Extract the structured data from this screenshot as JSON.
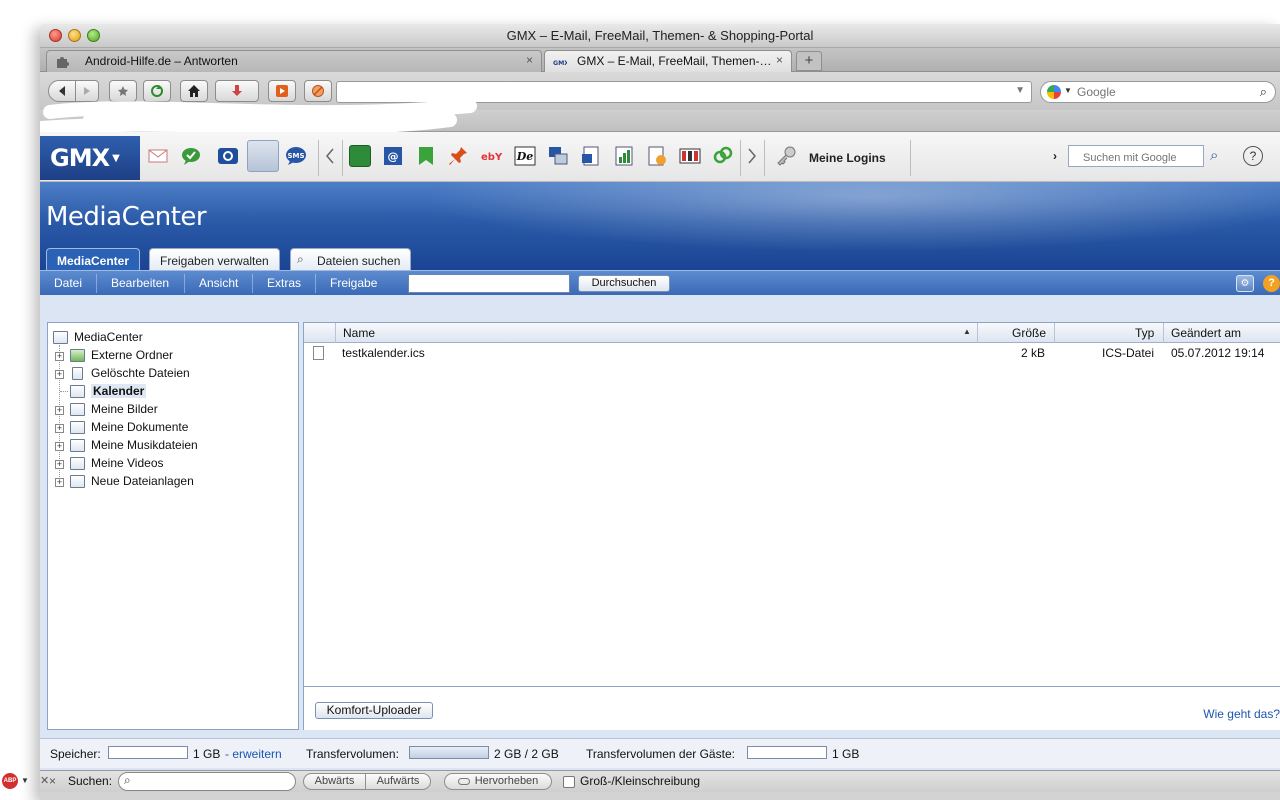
{
  "window": {
    "title": "GMX – E-Mail, FreeMail, Themen- & Shopping-Portal"
  },
  "browser_tabs": [
    {
      "label": "Android-Hilfe.de – Antworten",
      "active": false
    },
    {
      "label": "GMX – E-Mail, FreeMail, Themen-…",
      "active": true
    }
  ],
  "toolbar": {
    "websearch_placeholder": "Google",
    "new_tab_label": "+"
  },
  "gmx_toolbar": {
    "logo": "GMX",
    "icons": [
      "mail-icon",
      "chat-icon",
      "camera-icon",
      "mediacenter-icon",
      "sms-icon",
      "notebook-icon",
      "at-icon",
      "bookmark-icon",
      "pin-icon",
      "ebay-icon",
      "de-icon",
      "translate-icon",
      "word-icon",
      "chart-icon",
      "cube-icon",
      "calculator-icon",
      "link-icon"
    ],
    "sms_label": "SMS",
    "ebay_label": "ebY",
    "de_label": "De",
    "logins_label": "Meine Logins",
    "search_placeholder": "Suchen mit Google",
    "help_label": "?"
  },
  "app": {
    "title": "MediaCenter",
    "tabs": [
      {
        "label": "MediaCenter",
        "active": true
      },
      {
        "label": "Freigaben verwalten",
        "active": false
      },
      {
        "label": "Dateien suchen",
        "active": false
      }
    ],
    "menu": [
      "Datei",
      "Bearbeiten",
      "Ansicht",
      "Extras",
      "Freigabe"
    ],
    "search_button": "Durchsuchen",
    "tree": {
      "root": "MediaCenter",
      "items": [
        {
          "label": "Externe Ordner",
          "expandable": true,
          "selected": false
        },
        {
          "label": "Gelöschte Dateien",
          "expandable": true,
          "selected": false
        },
        {
          "label": "Kalender",
          "expandable": false,
          "selected": true
        },
        {
          "label": "Meine Bilder",
          "expandable": true,
          "selected": false
        },
        {
          "label": "Meine Dokumente",
          "expandable": true,
          "selected": false
        },
        {
          "label": "Meine Musikdateien",
          "expandable": true,
          "selected": false
        },
        {
          "label": "Meine Videos",
          "expandable": true,
          "selected": false
        },
        {
          "label": "Neue Dateianlagen",
          "expandable": true,
          "selected": false
        }
      ]
    },
    "files": {
      "columns": [
        "Name",
        "Größe",
        "Typ",
        "Geändert am"
      ],
      "rows": [
        {
          "name": "testkalender.ics",
          "size": "2 kB",
          "type": "ICS-Datei",
          "modified": "05.07.2012 19:14"
        }
      ]
    },
    "upload_button": "Komfort-Uploader",
    "help_link": "Wie geht das?",
    "status": {
      "storage_label": "Speicher:",
      "storage_value": "1 GB",
      "storage_link": "- erweitern",
      "storage_fraction": 0.0,
      "transfer_label": "Transfervolumen:",
      "transfer_value": "2 GB / 2 GB",
      "transfer_fraction": 1.0,
      "guest_label": "Transfervolumen der Gäste:",
      "guest_value": "1 GB",
      "guest_fraction": 0.0
    }
  },
  "findbar": {
    "close": "×",
    "label": "Suchen:",
    "prev": "Abwärts",
    "next": "Aufwärts",
    "highlight": "Hervorheben",
    "match_case": "Groß-/Kleinschreibung"
  },
  "addon": {
    "abp": "ABP"
  },
  "colors": {
    "gmx_blue": "#1d3f85",
    "menu_blue": "#3a6ab6",
    "link": "#1a56b0"
  }
}
